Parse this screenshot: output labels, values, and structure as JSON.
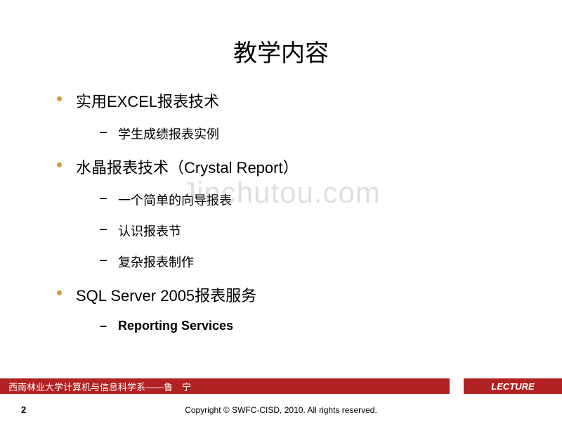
{
  "title": "教学内容",
  "bullets": {
    "item1": "实用EXCEL报表技术",
    "item1_sub1": "学生成绩报表实例",
    "item2": "水晶报表技术（Crystal Report）",
    "item2_sub1": "一个简单的向导报表",
    "item2_sub2": "认识报表节",
    "item2_sub3": "复杂报表制作",
    "item3": "SQL Server 2005报表服务",
    "item3_sub1": "Reporting Services"
  },
  "watermark": "Jinchutou.com",
  "footer": {
    "left": "西南林业大学计算机与信息科学系——鲁　宁",
    "right": "LECTURE"
  },
  "page_number": "2",
  "copyright": "Copyright © SWFC-CISD, 2010. All rights reserved."
}
